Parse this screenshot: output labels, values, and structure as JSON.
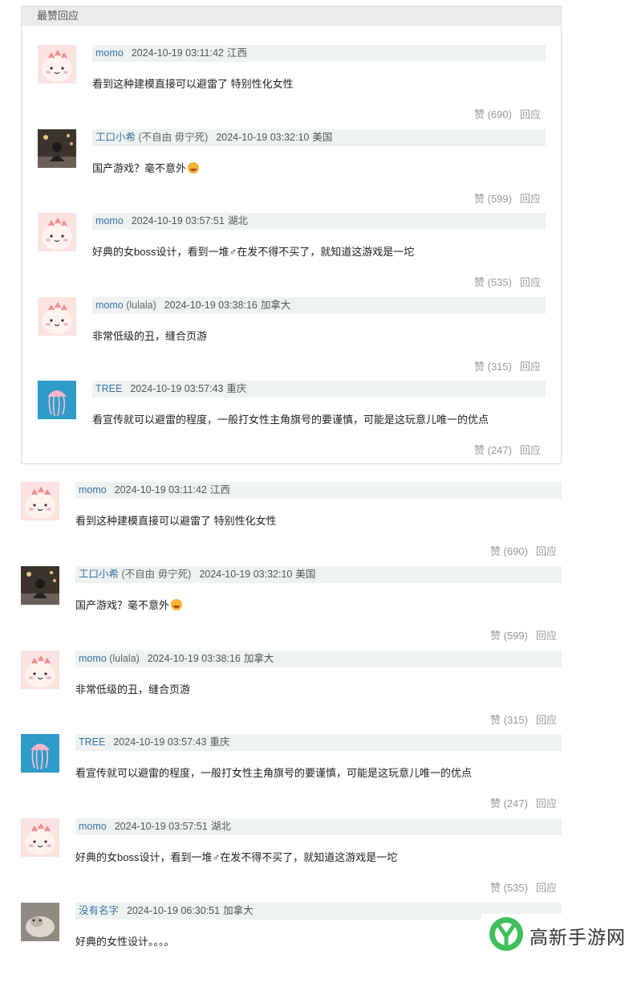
{
  "hot_section": {
    "title": "最赞回应",
    "comments": [
      {
        "user": "momo",
        "extra": "",
        "time": "2024-10-19 03:11:42",
        "loc": "江西",
        "text": "看到这种建模直接可以避雷了 特别性化女性",
        "emoji": false,
        "likes": "赞 (690)",
        "reply": "回应",
        "avatar": "pig-avatar"
      },
      {
        "user": "工口小希",
        "extra": "(不自由 毋宁死)",
        "time": "2024-10-19 03:32:10",
        "loc": "美国",
        "text": "国产游戏？毫不意外",
        "emoji": true,
        "likes": "赞 (599)",
        "reply": "回应",
        "avatar": "photo-avatar"
      },
      {
        "user": "momo",
        "extra": "",
        "time": "2024-10-19 03:57:51",
        "loc": "湖北",
        "text": "好典的女boss设计，看到一堆♂在发不得不买了，就知道这游戏是一坨",
        "emoji": false,
        "likes": "赞 (535)",
        "reply": "回应",
        "avatar": "pig-avatar"
      },
      {
        "user": "momo",
        "extra": "(lulala)",
        "time": "2024-10-19 03:38:16",
        "loc": "加拿大",
        "text": "非常低级的丑，缝合页游",
        "emoji": false,
        "likes": "赞 (315)",
        "reply": "回应",
        "avatar": "pig-avatar"
      },
      {
        "user": "TREE",
        "extra": "",
        "time": "2024-10-19 03:57:43",
        "loc": "重庆",
        "text": "看宣传就可以避雷的程度，一般打女性主角旗号的要谨慎，可能是这玩意儿唯一的优点",
        "emoji": false,
        "likes": "赞 (247)",
        "reply": "回应",
        "avatar": "jellyfish-avatar"
      }
    ]
  },
  "main_comments": [
    {
      "user": "momo",
      "extra": "",
      "time": "2024-10-19 03:11:42",
      "loc": "江西",
      "text": "看到这种建模直接可以避雷了 特别性化女性",
      "emoji": false,
      "likes": "赞 (690)",
      "reply": "回应",
      "avatar": "pig-avatar"
    },
    {
      "user": "工口小希",
      "extra": "(不自由 毋宁死)",
      "time": "2024-10-19 03:32:10",
      "loc": "美国",
      "text": "国产游戏？毫不意外",
      "emoji": true,
      "likes": "赞 (599)",
      "reply": "回应",
      "avatar": "photo-avatar"
    },
    {
      "user": "momo",
      "extra": "(lulala)",
      "time": "2024-10-19 03:38:16",
      "loc": "加拿大",
      "text": "非常低级的丑，缝合页游",
      "emoji": false,
      "likes": "赞 (315)",
      "reply": "回应",
      "avatar": "pig-avatar"
    },
    {
      "user": "TREE",
      "extra": "",
      "time": "2024-10-19 03:57:43",
      "loc": "重庆",
      "text": "看宣传就可以避雷的程度，一般打女性主角旗号的要谨慎，可能是这玩意儿唯一的优点",
      "emoji": false,
      "likes": "赞 (247)",
      "reply": "回应",
      "avatar": "jellyfish-avatar"
    },
    {
      "user": "momo",
      "extra": "",
      "time": "2024-10-19 03:57:51",
      "loc": "湖北",
      "text": "好典的女boss设计，看到一堆♂在发不得不买了，就知道这游戏是一坨",
      "emoji": false,
      "likes": "赞 (535)",
      "reply": "回应",
      "avatar": "pig-avatar"
    },
    {
      "user": "没有名字",
      "extra": "",
      "time": "2024-10-19 06:30:51",
      "loc": "加拿大",
      "text": "好典的女性设计。。。。",
      "emoji": false,
      "likes": "",
      "reply": "",
      "avatar": "cat-avatar"
    }
  ],
  "watermark": {
    "text": "高新手游网",
    "icon": "gaoxin-logo-icon"
  },
  "colors": {
    "username": "#3a6fa6",
    "meta_bg": "#eef3f1",
    "muted": "#999999"
  }
}
